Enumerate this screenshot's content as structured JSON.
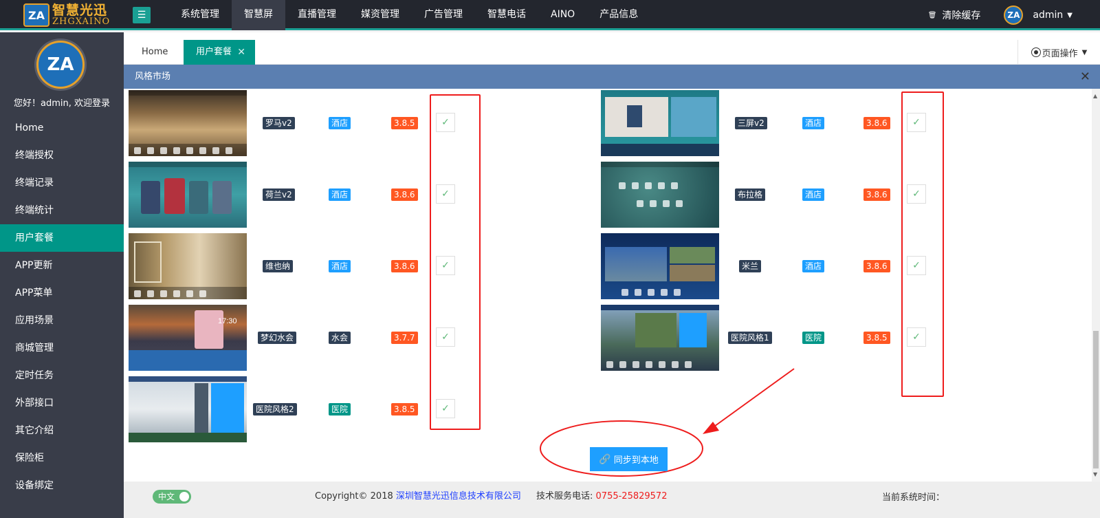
{
  "header": {
    "logo_text_cn": "智慧光迅",
    "logo_text_en": "ZHGXAINO",
    "logo_badge": "ZA",
    "nav": [
      "系统管理",
      "智慧屏",
      "直播管理",
      "媒资管理",
      "广告管理",
      "智慧电话",
      "AINO",
      "产品信息"
    ],
    "active_nav": "智慧屏",
    "clear_cache": "清除缓存",
    "user": "admin"
  },
  "sidebar": {
    "avatar": "ZA",
    "welcome": "您好！admin, 欢迎登录",
    "items": [
      "Home",
      "终端授权",
      "终端记录",
      "终端统计",
      "用户套餐",
      "APP更新",
      "APP菜单",
      "应用场景",
      "商城管理",
      "定时任务",
      "外部接口",
      "其它介绍",
      "保险柜",
      "设备绑定"
    ],
    "active": "用户套餐"
  },
  "tabs": {
    "home": "Home",
    "active": "用户套餐",
    "close": "✕",
    "page_ops": "页面操作"
  },
  "modal": {
    "title": "风格市场",
    "close": "✕",
    "left": [
      {
        "name": "罗马v2",
        "category": "酒店",
        "version": "3.8.5"
      },
      {
        "name": "荷兰v2",
        "category": "酒店",
        "version": "3.8.6"
      },
      {
        "name": "维也纳",
        "category": "酒店",
        "version": "3.8.6"
      },
      {
        "name": "梦幻水会",
        "category": "水会",
        "version": "3.7.7"
      },
      {
        "name": "医院风格2",
        "category": "医院",
        "version": "3.8.5"
      }
    ],
    "right": [
      {
        "name": "三屏v2",
        "category": "酒店",
        "version": "3.8.6"
      },
      {
        "name": "布拉格",
        "category": "酒店",
        "version": "3.8.6"
      },
      {
        "name": "米兰",
        "category": "酒店",
        "version": "3.8.6"
      },
      {
        "name": "医院风格1",
        "category": "医院",
        "version": "3.8.5"
      }
    ],
    "sync_button": "同步到本地"
  },
  "footer": {
    "lang": "中文",
    "copyright_prefix": "Copyright© 2018",
    "company": "深圳智慧光迅信息技术有限公司",
    "support_label": "技术服务电话:",
    "support_tel": "0755-25829572",
    "system_time_label": "当前系统时间："
  },
  "colors": {
    "accent": "#009688",
    "topbar": "#23262e",
    "sidebar": "#393d49",
    "modal_header": "#5b7fb1",
    "version_tag": "#ff5722",
    "category_tag": "#1e9fff",
    "annotation_red": "#ee1c1c"
  }
}
